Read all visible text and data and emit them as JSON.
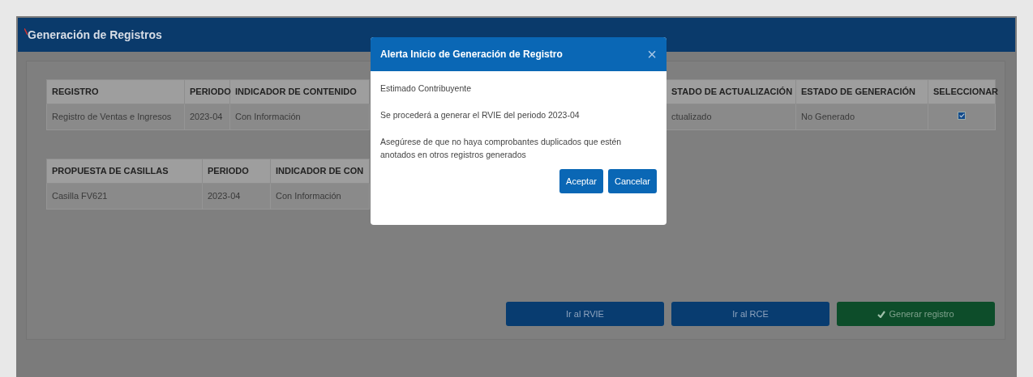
{
  "page_title": "Generación de Registros",
  "registro_table": {
    "columns": [
      "REGISTRO",
      "PERIODO",
      "INDICADOR DE CONTENIDO",
      "STADO DE ACTUALIZACIÓN",
      "ESTADO DE GENERACIÓN",
      "SELECCIONAR"
    ],
    "rows": [
      {
        "cells": [
          "Registro de Ventas e Ingresos",
          "2023-04",
          "Con Información",
          "ctualizado",
          "No Generado"
        ],
        "checked": true
      }
    ]
  },
  "casillas_table": {
    "columns": [
      "PROPUESTA DE CASILLAS",
      "PERIODO",
      "INDICADOR DE CON"
    ],
    "rows": [
      {
        "cells": [
          "Casilla FV621",
          "2023-04",
          "Con Información"
        ]
      }
    ]
  },
  "buttons": [
    {
      "label": "Ir al RVIE",
      "kind": "primary"
    },
    {
      "label": "Ir al RCE",
      "kind": "primary"
    },
    {
      "label": "Generar registro",
      "kind": "success"
    }
  ],
  "modal": {
    "title": "Alerta Inicio de Generación de Registro",
    "close": "×",
    "paragraphs": [
      "Estimado Contribuyente",
      "Se procederá a generar el RVIE del periodo 2023-04",
      "Asegúrese de que no haya comprobantes duplicados que estén anotados en otros registros generados"
    ],
    "buttons": [
      "Aceptar",
      "Cancelar"
    ]
  }
}
